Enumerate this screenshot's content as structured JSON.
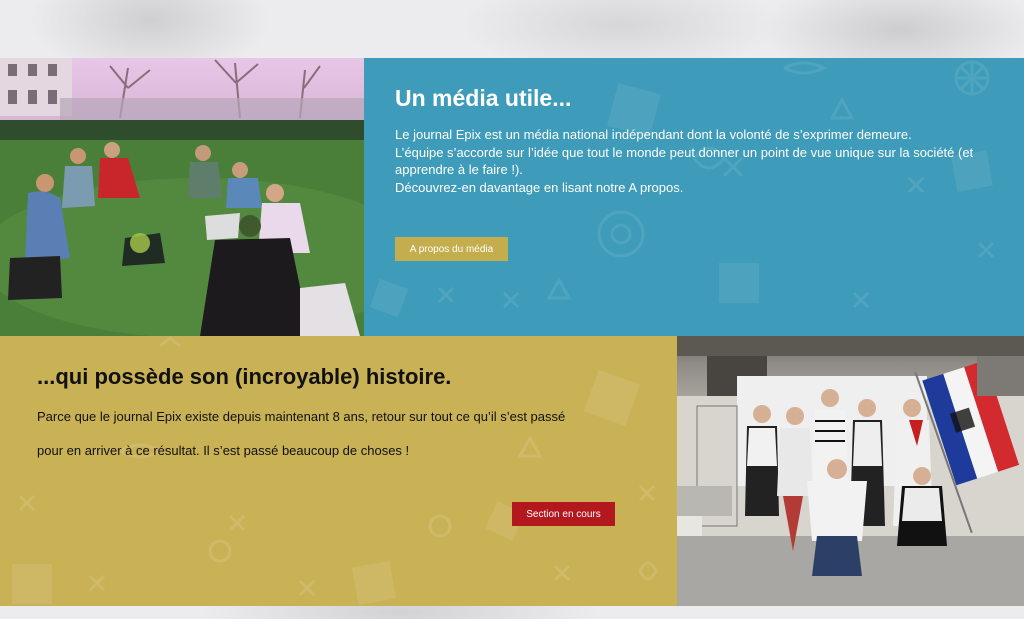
{
  "media_section": {
    "title": "Un média utile...",
    "paragraphs": [
      "Le journal Epix est un média national indépendant dont la volonté de s’exprimer demeure.",
      "L’équipe s’accorde sur l’idée que tout le monde peut donner un point de vue unique sur la société (et apprendre à le faire !).",
      "Découvrez-en davantage en lisant notre A propos."
    ],
    "button_label": "A propos du média",
    "background_color": "#3e9bb9",
    "button_color": "#c4ad4c"
  },
  "history_section": {
    "title": "...qui possède son (incroyable) histoire.",
    "paragraphs": [
      "Parce que le journal Epix existe depuis maintenant 8 ans,  retour sur tout ce qu’il s’est passé",
      "pour en arriver à ce résultat. Il s’est passé beaucoup de choses !"
    ],
    "button_label": "Section en cours",
    "background_color": "#c9b155",
    "button_color": "#b3181f"
  },
  "images": {
    "photo_1": "students-sitting-on-grass-photo",
    "photo_2": "team-dressed-as-french-mimes-with-flag-photo"
  },
  "icons": [
    "camera-icon",
    "pencil-icon",
    "book-icon",
    "ship-wheel-icon",
    "eye-icon",
    "star-icon"
  ]
}
